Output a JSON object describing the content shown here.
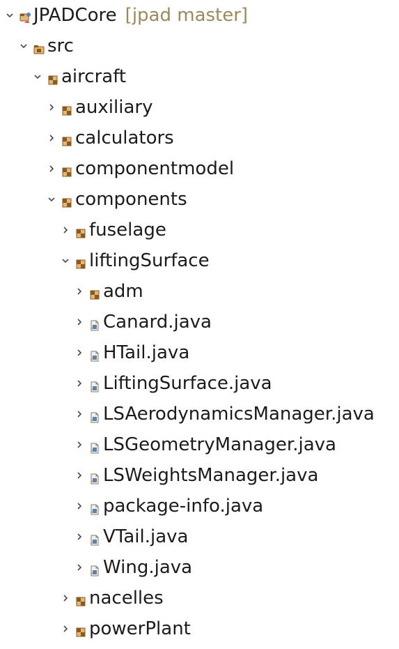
{
  "tree": {
    "project": {
      "label": "JPADCore",
      "decoration": "[jpad master]",
      "icon": "java-project-icon",
      "expanded": true
    },
    "items": [
      {
        "label": "src",
        "icon": "source-folder-icon",
        "expanded": true,
        "has_children": true
      },
      {
        "label": "aircraft",
        "icon": "package-icon",
        "expanded": true,
        "has_children": true
      },
      {
        "label": "auxiliary",
        "icon": "package-icon",
        "expanded": false,
        "has_children": true
      },
      {
        "label": "calculators",
        "icon": "package-icon",
        "expanded": false,
        "has_children": true
      },
      {
        "label": "componentmodel",
        "icon": "package-icon",
        "expanded": false,
        "has_children": true
      },
      {
        "label": "components",
        "icon": "package-icon",
        "expanded": true,
        "has_children": true
      },
      {
        "label": "fuselage",
        "icon": "package-icon",
        "expanded": false,
        "has_children": true
      },
      {
        "label": "liftingSurface",
        "icon": "package-icon",
        "expanded": true,
        "has_children": true
      },
      {
        "label": "adm",
        "icon": "package-icon",
        "expanded": false,
        "has_children": true
      },
      {
        "label": "Canard.java",
        "icon": "java-file-icon",
        "expanded": false,
        "has_children": true
      },
      {
        "label": "HTail.java",
        "icon": "java-file-icon",
        "expanded": false,
        "has_children": true
      },
      {
        "label": "LiftingSurface.java",
        "icon": "java-file-icon",
        "expanded": false,
        "has_children": true
      },
      {
        "label": "LSAerodynamicsManager.java",
        "icon": "java-file-icon",
        "expanded": false,
        "has_children": true
      },
      {
        "label": "LSGeometryManager.java",
        "icon": "java-file-icon",
        "expanded": false,
        "has_children": true
      },
      {
        "label": "LSWeightsManager.java",
        "icon": "java-file-icon",
        "expanded": false,
        "has_children": true
      },
      {
        "label": "package-info.java",
        "icon": "java-file-icon",
        "expanded": false,
        "has_children": true
      },
      {
        "label": "VTail.java",
        "icon": "java-file-icon",
        "expanded": false,
        "has_children": true
      },
      {
        "label": "Wing.java",
        "icon": "java-file-icon",
        "expanded": false,
        "has_children": true
      },
      {
        "label": "nacelles",
        "icon": "package-icon",
        "expanded": false,
        "has_children": true
      },
      {
        "label": "powerPlant",
        "icon": "package-icon",
        "expanded": false,
        "has_children": true
      }
    ]
  },
  "colors": {
    "text": "#1b1b1b",
    "decoration": "#9c8a5e",
    "twisty": "#4a4a4a",
    "package_brown": "#8a5a1e",
    "package_tan": "#e2b777",
    "file_blue": "#5b7fb8",
    "file_page": "#f4f1e6"
  }
}
